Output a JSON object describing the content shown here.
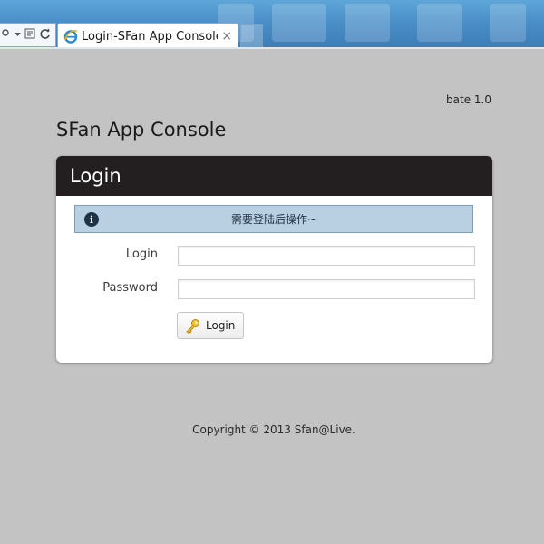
{
  "browser": {
    "tab_title": "Login-SFan App Console",
    "tab_close": "×",
    "icons": [
      "refresh-icon",
      "ie-icon",
      "close-icon"
    ]
  },
  "page": {
    "version": "bate 1.0",
    "app_title": "SFan App Console",
    "panel_title": "Login",
    "alert_text": "需要登陆后操作~",
    "fields": {
      "login_label": "Login",
      "login_value": "",
      "password_label": "Password",
      "password_value": ""
    },
    "login_button": "Login",
    "copyright": "Copyright © 2013 Sfan@Live."
  },
  "colors": {
    "page_bg": "#c3c3c3",
    "panel_header": "#231f20",
    "alert_bg": "#b8d0e2"
  }
}
